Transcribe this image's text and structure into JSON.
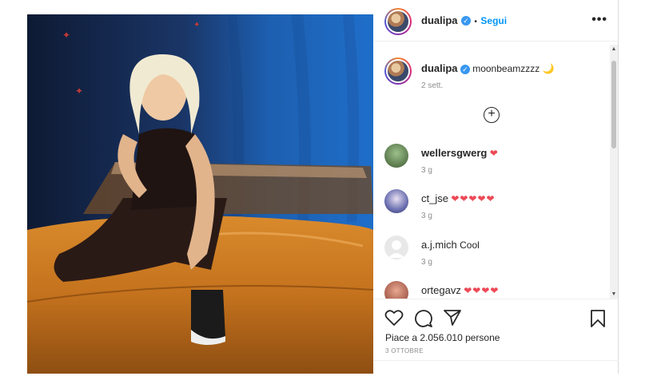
{
  "post": {
    "author": "dualipa",
    "follow_label": "Segui",
    "more_label": "•••",
    "caption_text": "moonbeamzzzz",
    "caption_emoji": "🌙",
    "caption_age": "2 sett."
  },
  "comments": [
    {
      "user": "wellersgwerg",
      "text": "",
      "hearts": "❤",
      "age": "3 g"
    },
    {
      "user": "ct_jse",
      "text": "",
      "hearts": "❤❤❤❤❤",
      "age": "3 g"
    },
    {
      "user": "a.j.mich",
      "text": "Cool",
      "hearts": "",
      "age": "3 g"
    },
    {
      "user": "ortegavz",
      "text": "",
      "hearts": "❤❤❤❤",
      "age": ""
    }
  ],
  "actions": {
    "likes": "Piace a 2.056.010 persone",
    "date": "3 OTTOBRE"
  },
  "icons": {
    "verified": "verified-badge-icon",
    "like": "heart-outline-icon",
    "comment": "comment-bubble-icon",
    "share": "paper-plane-icon",
    "save": "bookmark-icon",
    "add": "plus-circle-icon",
    "next": "chevron-right-icon"
  },
  "colors": {
    "link_blue": "#0095f6",
    "verified_blue": "#3897f0",
    "heart_red": "#ed4956",
    "muted": "#8e8e8e"
  }
}
